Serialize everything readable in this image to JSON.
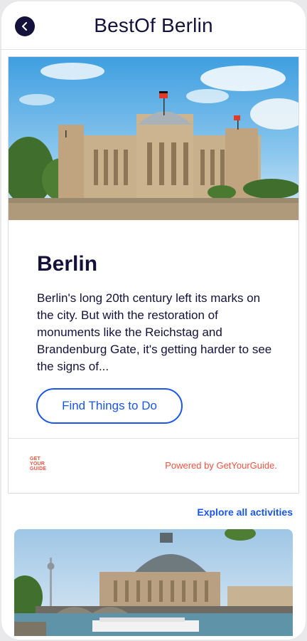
{
  "header": {
    "title": "BestOf Berlin",
    "back_icon": "chevron-left-icon"
  },
  "card": {
    "title": "Berlin",
    "description": "Berlin's long 20th century left its marks on the city. But with the restoration of monuments like the Reichstag and Brandenburg Gate, it's getting harder to see the signs of...",
    "cta_label": "Find Things to Do",
    "logo_lines": [
      "GET",
      "YOUR",
      "GUIDE"
    ],
    "powered_by": "Powered by GetYourGuide."
  },
  "explore_link": "Explore all activities",
  "colors": {
    "navy": "#14123b",
    "accent_blue": "#1a56e8",
    "gyg_orange": "#f0533f"
  }
}
